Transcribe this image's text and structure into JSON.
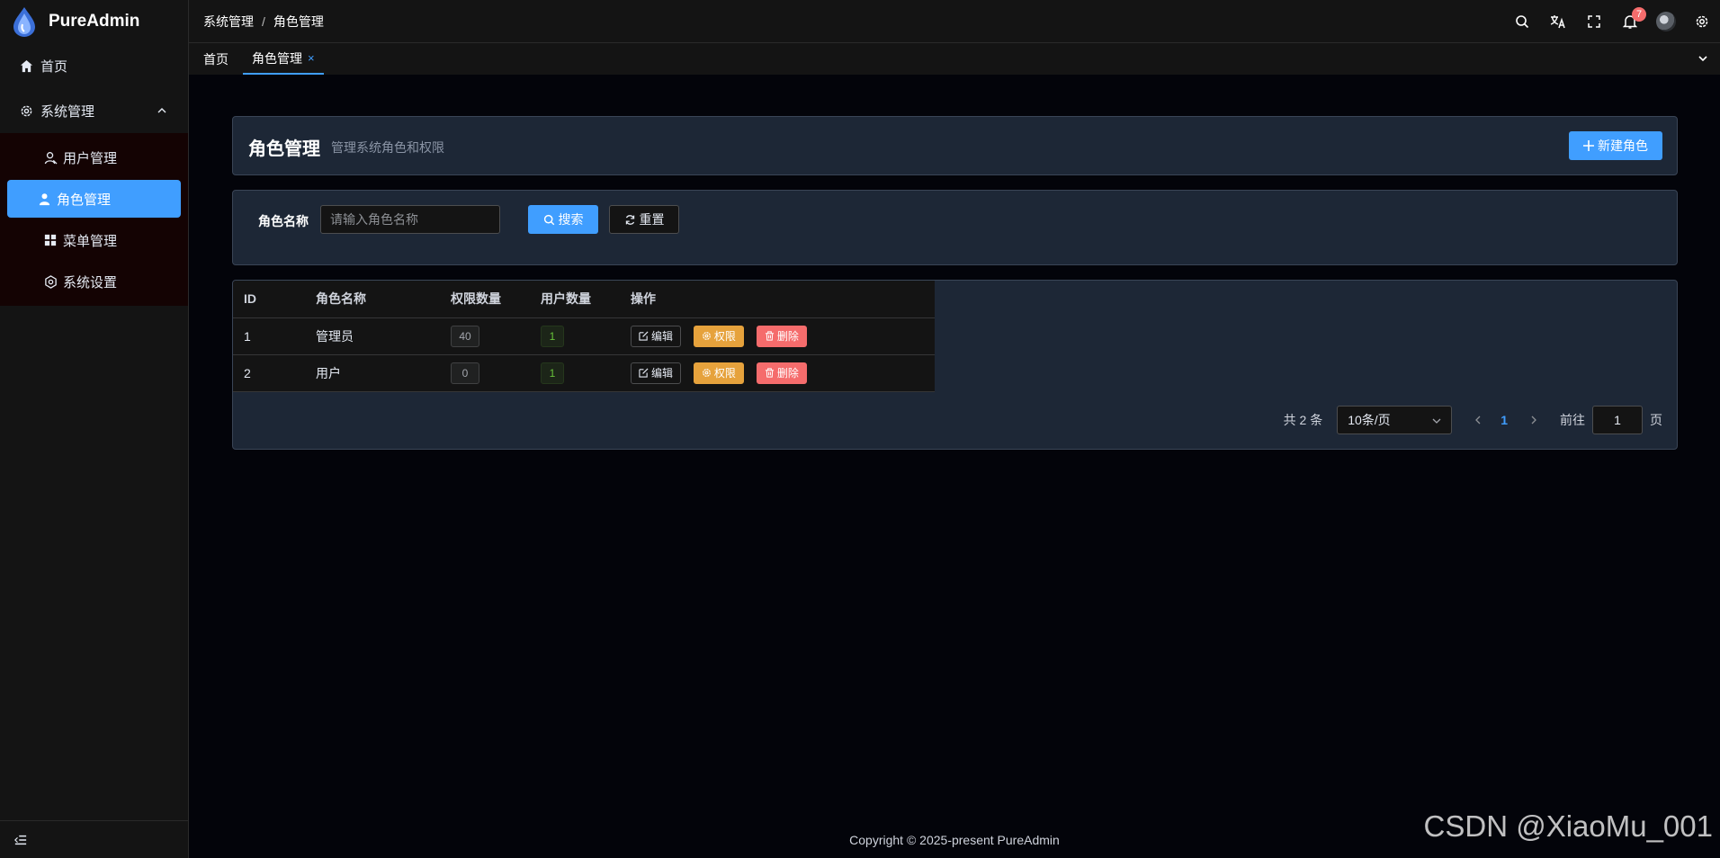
{
  "app": {
    "name": "PureAdmin"
  },
  "sidebar": {
    "home": {
      "label": "首页",
      "icon": "home-icon"
    },
    "system": {
      "label": "系统管理",
      "icon": "gear-icon"
    },
    "items": [
      {
        "label": "用户管理",
        "icon": "user-icon"
      },
      {
        "label": "角色管理",
        "icon": "role-icon"
      },
      {
        "label": "菜单管理",
        "icon": "grid-icon"
      },
      {
        "label": "系统设置",
        "icon": "gear-icon"
      }
    ]
  },
  "header": {
    "breadcrumb": [
      "系统管理",
      "/",
      "角色管理"
    ],
    "notification_count": "7"
  },
  "tabs": [
    {
      "label": "首页"
    },
    {
      "label": "角色管理",
      "close": "×"
    }
  ],
  "page": {
    "title": "角色管理",
    "subtitle": "管理系统角色和权限",
    "new_button": "新建角色"
  },
  "search": {
    "label": "角色名称",
    "placeholder": "请输入角色名称",
    "search_button": "搜索",
    "reset_button": "重置"
  },
  "table": {
    "columns": [
      "ID",
      "角色名称",
      "权限数量",
      "用户数量",
      "操作"
    ],
    "rows": [
      {
        "id": "1",
        "name": "管理员",
        "permissions": "40",
        "users": "1"
      },
      {
        "id": "2",
        "name": "用户",
        "permissions": "0",
        "users": "1"
      }
    ],
    "actions": {
      "edit": "编辑",
      "perm": "权限",
      "delete": "删除"
    }
  },
  "pagination": {
    "total": "共 2 条",
    "page_size": "10条/页",
    "current": "1",
    "goto_label": "前往",
    "goto_value": "1",
    "goto_suffix": "页"
  },
  "footer": {
    "copyright": "Copyright © 2025-present PureAdmin"
  },
  "watermark": "CSDN @XiaoMu_001",
  "colors": {
    "primary": "#409eff",
    "warning": "#e6a23c",
    "danger": "#f56c6c",
    "success": "#67c23a"
  }
}
